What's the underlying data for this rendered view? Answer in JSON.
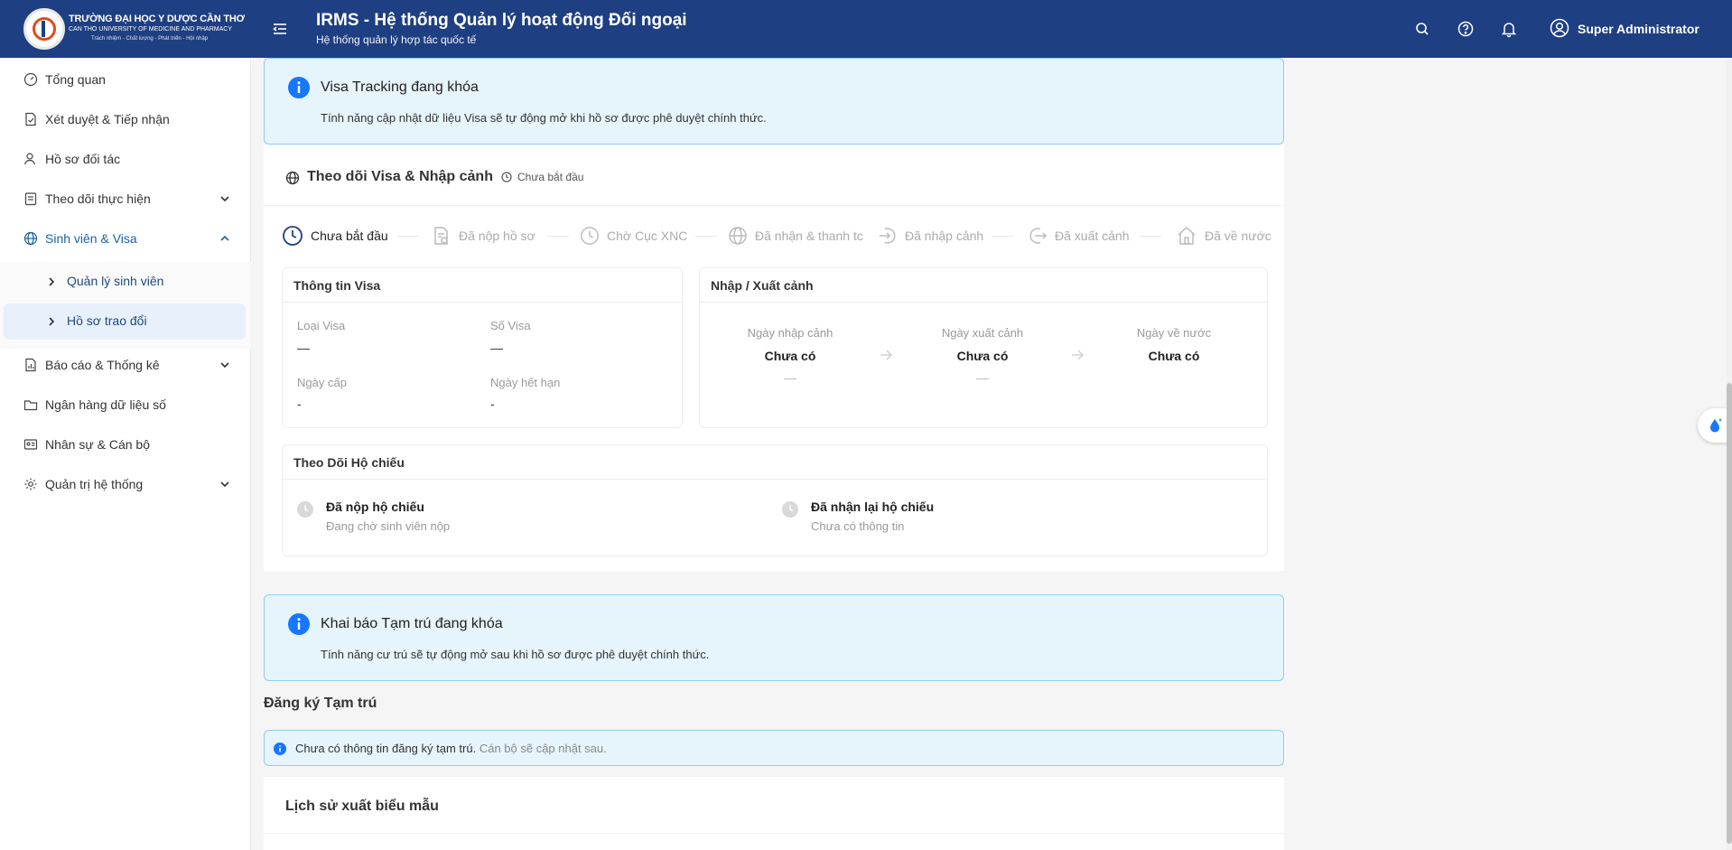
{
  "logo": {
    "line1": "TRƯỜNG ĐẠI HỌC Y DƯỢC CẦN THƠ",
    "line2": "CAN THO UNIVERSITY OF MEDICINE AND PHARMACY",
    "line3": "Trách nhiệm - Chất lượng - Phát triển - Hội nhập"
  },
  "header": {
    "title": "IRMS - Hệ thống Quản lý hoạt động Đối ngoại",
    "subtitle": "Hệ thống quản lý hợp tác quốc tế",
    "user": "Super Administrator",
    "icons": [
      "search-icon",
      "help-icon",
      "bell-icon",
      "user-icon"
    ]
  },
  "sidebar": {
    "items": [
      {
        "label": "Tổng quan",
        "icon": "dashboard-icon"
      },
      {
        "label": "Xét duyệt & Tiếp nhận",
        "icon": "file-check-icon"
      },
      {
        "label": "Hồ sơ đối tác",
        "icon": "partner-icon"
      },
      {
        "label": "Theo dõi thực hiện",
        "icon": "clipboard-icon"
      },
      {
        "label": "Sinh viên & Visa",
        "icon": "globe-icon"
      },
      {
        "label": "Báo cáo & Thống kê",
        "icon": "report-icon"
      },
      {
        "label": "Ngân hàng dữ liệu số",
        "icon": "folder-icon"
      },
      {
        "label": "Nhân sự & Cán bộ",
        "icon": "id-card-icon"
      },
      {
        "label": "Quản trị hệ thống",
        "icon": "gear-icon"
      }
    ],
    "subitems": [
      {
        "label": "Quản lý sinh viên"
      },
      {
        "label": "Hồ sơ trao đổi"
      }
    ]
  },
  "visa_alert": {
    "title": "Visa Tracking đang khóa",
    "desc": "Tính năng cập nhật dữ liệu Visa sẽ tự động mở khi hồ sơ được phê duyệt chính thức."
  },
  "visa_card": {
    "title": "Theo dõi Visa & Nhập cảnh",
    "status": "Chưa bắt đầu",
    "steps": [
      {
        "label": "Chưa bắt đầu"
      },
      {
        "label": "Đã nộp hồ sơ"
      },
      {
        "label": "Chờ Cục XNC"
      },
      {
        "label": "Đã nhận & thanh tc"
      },
      {
        "label": "Đã nhập cảnh"
      },
      {
        "label": "Đã xuất cảnh"
      },
      {
        "label": "Đã về nước"
      }
    ],
    "visa_info": {
      "title": "Thông tin Visa",
      "type_label": "Loại Visa",
      "type_value": "—",
      "number_label": "Số Visa",
      "number_value": "—",
      "issue_label": "Ngày cấp",
      "issue_value": "-",
      "expiry_label": "Ngày hết hạn",
      "expiry_value": "-"
    },
    "entry_exit": {
      "title": "Nhập / Xuất cảnh",
      "entry_label": "Ngày nhập cảnh",
      "entry_value": "Chưa có",
      "entry_sub": "—",
      "exit_label": "Ngày xuất cảnh",
      "exit_value": "Chưa có",
      "exit_sub": "—",
      "return_label": "Ngày về nước",
      "return_value": "Chưa có"
    },
    "passport": {
      "title": "Theo Dõi Hộ chiếu",
      "submitted_title": "Đã nộp hộ chiếu",
      "submitted_sub": "Đang chờ sinh viên nộp",
      "returned_title": "Đã nhận lại hộ chiếu",
      "returned_sub": "Chưa có thông tin"
    }
  },
  "residence_alert": {
    "title": "Khai báo Tạm trú đang khóa",
    "desc": "Tính năng cư trú sẽ tự động mở sau khi hồ sơ được phê duyệt chính thức."
  },
  "residence": {
    "title": "Đăng ký Tạm trú",
    "info": "Chưa có thông tin đăng ký tạm trú.",
    "info_sub": "Cán bộ sẽ cập nhật sau."
  },
  "history": {
    "title": "Lịch sử xuất biểu mẫu"
  },
  "colors": {
    "header_bg": "#1e3f82",
    "accent": "#1677ff",
    "alert_bg": "#e6f4fc",
    "alert_border": "#91cdf0"
  }
}
